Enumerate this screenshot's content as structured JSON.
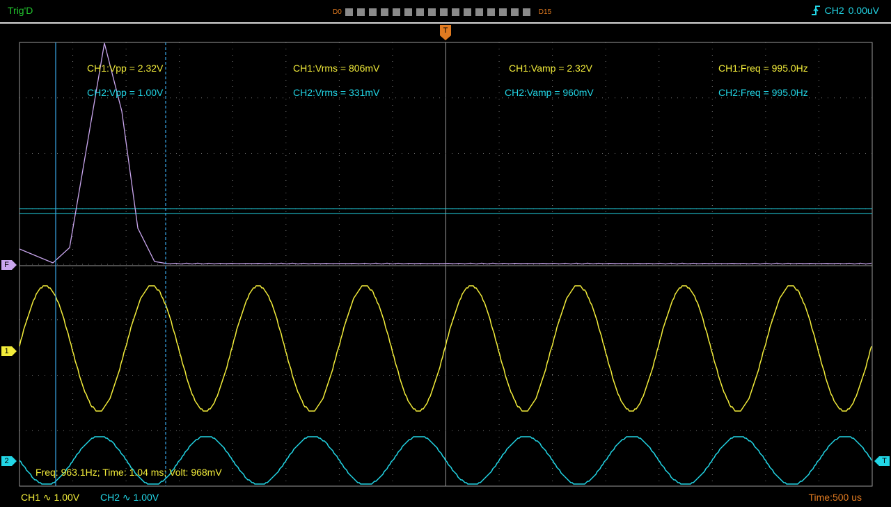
{
  "topbar": {
    "trigger_status": "Trig'D",
    "digital_start": "D0",
    "digital_end": "D15",
    "trigger_source": "CH2",
    "trigger_level": "0.00uV"
  },
  "markers": {
    "trigger_time": "T",
    "math": "F",
    "ch1": "1",
    "ch2": "2",
    "trigger_level": "T"
  },
  "measurements": {
    "ch1": {
      "vpp": "CH1:Vpp = 2.32V",
      "vrms": "CH1:Vrms = 806mV",
      "vamp": "CH1:Vamp = 2.32V",
      "freq": "CH1:Freq = 995.0Hz"
    },
    "ch2": {
      "vpp": "CH2:Vpp = 1.00V",
      "vrms": "CH2:Vrms = 331mV",
      "vamp": "CH2:Vamp = 960mV",
      "freq": "CH2:Freq = 995.0Hz"
    }
  },
  "cursor_readout": "Freq: 963.1Hz; Time: 1.04 ms; Volt: 968mV",
  "bottombar": {
    "ch1_scale": "CH1 ∿ 1.00V",
    "ch2_scale": "CH2 ∿ 1.00V",
    "timebase": "Time:500 us"
  },
  "colors": {
    "ch1": "#f2ec3a",
    "ch2": "#22d6e6",
    "math": "#c9a6ee",
    "trigger": "#e07a20",
    "cursor": "#3aa8e8",
    "status": "#22c22e"
  }
}
